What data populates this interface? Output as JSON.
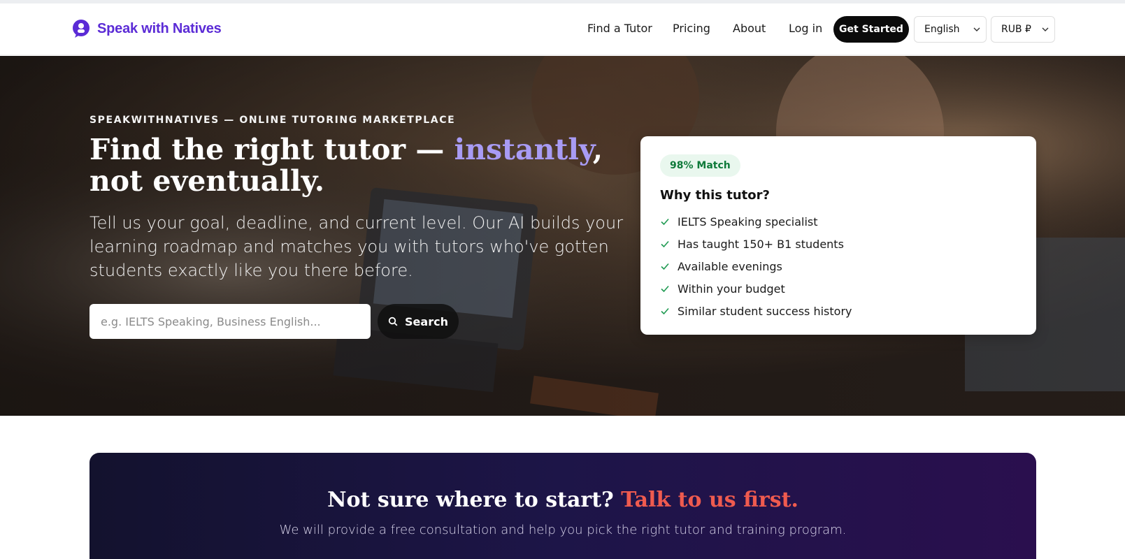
{
  "header": {
    "brand": "Speak with Natives",
    "nav": [
      {
        "label": "Find a Tutor"
      },
      {
        "label": "Pricing"
      },
      {
        "label": "About"
      },
      {
        "label": "Log in"
      }
    ],
    "cta_label": "Get Started",
    "language": "English",
    "currency": "RUB ₽",
    "brand_color": "#5b2bd6"
  },
  "hero": {
    "eyebrow": "SPEAKWITHNATIVES — ONLINE TUTORING MARKETPLACE",
    "title_part1": "Find the right tutor — ",
    "title_accent": "instantly",
    "title_part2": ", not eventually.",
    "description": "Tell us your goal, deadline, and current level. Our AI builds your learning roadmap and matches you with tutors who've gotten students exactly like you there before.",
    "search_placeholder": "e.g. IELTS Speaking, Business English...",
    "search_button": "Search",
    "accent_color": "#a89bf4"
  },
  "match_card": {
    "badge": "98% Match",
    "title": "Why this tutor?",
    "reasons": [
      "IELTS Speaking specialist",
      "Has taught 150+ B1 students",
      "Available evenings",
      "Within your budget",
      "Similar student success history"
    ],
    "check_color": "#1f9a52"
  },
  "consultation": {
    "title_part1": "Not sure where to start? ",
    "title_accent": "Talk to us first.",
    "subtitle": "We will provide a free consultation and help you pick the right tutor and training program.",
    "accent_color": "#ef5b4f"
  },
  "icons": {
    "logo": "chat-bubble-logo-icon",
    "search": "search-icon",
    "check": "check-icon",
    "chevron": "chevron-down-icon"
  }
}
